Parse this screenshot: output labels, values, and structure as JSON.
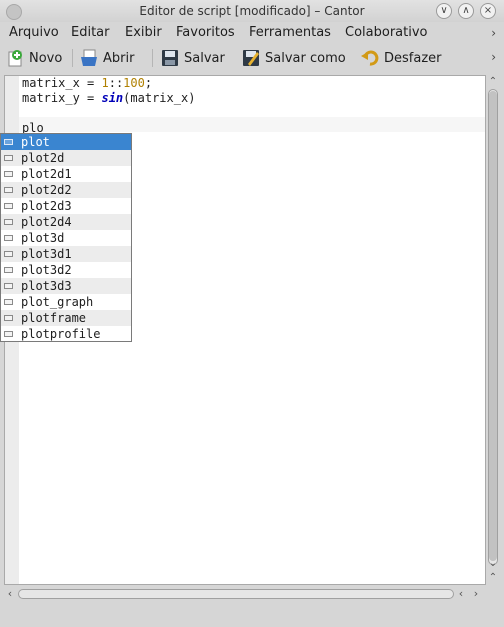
{
  "window": {
    "title": "Editor de script [modificado] – Cantor"
  },
  "menubar": {
    "items": [
      "Arquivo",
      "Editar",
      "Exibir",
      "Favoritos",
      "Ferramentas",
      "Colaborativo"
    ]
  },
  "toolbar": {
    "new_label": "Novo",
    "open_label": "Abrir",
    "save_label": "Salvar",
    "save_as_label": "Salvar como",
    "undo_label": "Desfazer"
  },
  "editor": {
    "lines": [
      {
        "plain": "matrix_x = ",
        "num1": "1",
        "mid": "::",
        "num2": "100",
        "end": ";"
      },
      {
        "plain": "matrix_y = ",
        "fn": "sin",
        "rest": "(matrix_x)"
      },
      {
        "plain": ""
      },
      {
        "plain": "plo"
      }
    ]
  },
  "autocomplete": {
    "items": [
      "plot",
      "plot2d",
      "plot2d1",
      "plot2d2",
      "plot2d3",
      "plot2d4",
      "plot3d",
      "plot3d1",
      "plot3d2",
      "plot3d3",
      "plot_graph",
      "plotframe",
      "plotprofile"
    ],
    "selected_index": 0
  },
  "colors": {
    "selection": "#3a85d0",
    "number": "#b08000",
    "function": "#0000b8"
  }
}
